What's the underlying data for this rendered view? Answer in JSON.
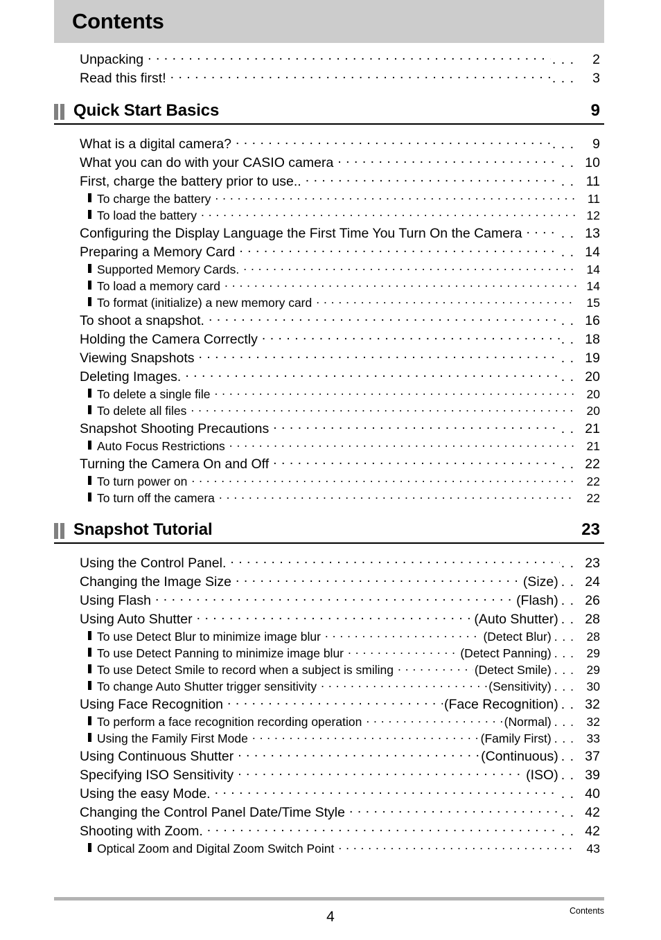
{
  "header": {
    "title": "Contents",
    "band_color": "#cccccc"
  },
  "footer": {
    "page_number": "4",
    "label": "Contents",
    "bar_color": "#b3b3b3"
  },
  "icons": {
    "section_marker": "double-bar-icon",
    "sub_item_marker": "bar-bullet-icon"
  },
  "intro_entries": [
    {
      "label": "Unpacking",
      "suffix": "",
      "tail": ". . .",
      "page": "2"
    },
    {
      "label": "Read this first!",
      "suffix": "",
      "tail": ". . .",
      "page": "3"
    }
  ],
  "sections": [
    {
      "title": "Quick Start Basics",
      "page": "9",
      "entries": [
        {
          "level": 1,
          "label": "What is a digital camera?",
          "suffix": "",
          "tail": ". . .",
          "page": "9"
        },
        {
          "level": 1,
          "label": "What you can do with your CASIO camera",
          "suffix": "",
          "tail": ". .",
          "page": "10"
        },
        {
          "level": 1,
          "label": "First, charge the battery prior to use..",
          "suffix": "",
          "tail": ". .",
          "page": "11"
        },
        {
          "level": 2,
          "label": "To charge the battery",
          "suffix": "",
          "tail": "",
          "page": "11"
        },
        {
          "level": 2,
          "label": "To load the battery",
          "suffix": "",
          "tail": "",
          "page": "12"
        },
        {
          "level": 1,
          "label": "Configuring the Display Language the First Time You Turn On the Camera",
          "suffix": "",
          "tail": ". .",
          "page": "13"
        },
        {
          "level": 1,
          "label": "Preparing a Memory Card",
          "suffix": "",
          "tail": ". .",
          "page": "14"
        },
        {
          "level": 2,
          "label": "Supported Memory Cards.",
          "suffix": "",
          "tail": "",
          "page": "14"
        },
        {
          "level": 2,
          "label": "To load a memory card",
          "suffix": "",
          "tail": "",
          "page": "14"
        },
        {
          "level": 2,
          "label": "To format (initialize) a new memory card",
          "suffix": "",
          "tail": "",
          "page": "15"
        },
        {
          "level": 1,
          "label": "To shoot a snapshot.",
          "suffix": "",
          "tail": ". .",
          "page": "16"
        },
        {
          "level": 1,
          "label": "Holding the Camera Correctly",
          "suffix": "",
          "tail": ". .",
          "page": "18"
        },
        {
          "level": 1,
          "label": "Viewing Snapshots",
          "suffix": "",
          "tail": ". .",
          "page": "19"
        },
        {
          "level": 1,
          "label": "Deleting Images.",
          "suffix": "",
          "tail": ". .",
          "page": "20"
        },
        {
          "level": 2,
          "label": "To delete a single file",
          "suffix": "",
          "tail": "",
          "page": "20"
        },
        {
          "level": 2,
          "label": "To delete all files",
          "suffix": "",
          "tail": "",
          "page": "20"
        },
        {
          "level": 1,
          "label": "Snapshot Shooting Precautions",
          "suffix": "",
          "tail": ". .",
          "page": "21"
        },
        {
          "level": 2,
          "label": "Auto Focus Restrictions",
          "suffix": "",
          "tail": "",
          "page": "21"
        },
        {
          "level": 1,
          "label": "Turning the Camera On and Off",
          "suffix": "",
          "tail": ". .",
          "page": "22"
        },
        {
          "level": 2,
          "label": "To turn power on",
          "suffix": "",
          "tail": "",
          "page": "22"
        },
        {
          "level": 2,
          "label": "To turn off the camera",
          "suffix": "",
          "tail": "",
          "page": "22"
        }
      ]
    },
    {
      "title": "Snapshot Tutorial",
      "page": "23",
      "entries": [
        {
          "level": 1,
          "label": "Using the Control Panel.",
          "suffix": "",
          "tail": ". .",
          "page": "23"
        },
        {
          "level": 1,
          "label": "Changing the Image Size",
          "suffix": "(Size)",
          "tail": ". .",
          "page": "24"
        },
        {
          "level": 1,
          "label": "Using Flash",
          "suffix": "(Flash)",
          "tail": ". .",
          "page": "26"
        },
        {
          "level": 1,
          "label": "Using Auto Shutter",
          "suffix": "(Auto Shutter)",
          "tail": ". .",
          "page": "28"
        },
        {
          "level": 2,
          "label": "To use Detect Blur to minimize image blur",
          "suffix": "(Detect Blur)",
          "tail": ". . .",
          "page": "28"
        },
        {
          "level": 2,
          "label": "To use Detect Panning to minimize image blur",
          "suffix": "(Detect Panning)",
          "tail": ". . .",
          "page": "29"
        },
        {
          "level": 2,
          "label": "To use Detect Smile to record when a subject is smiling",
          "suffix": "(Detect Smile)",
          "tail": ". . .",
          "page": "29"
        },
        {
          "level": 2,
          "label": "To change Auto Shutter trigger sensitivity",
          "suffix": "(Sensitivity)",
          "tail": ". . .",
          "page": "30"
        },
        {
          "level": 1,
          "label": "Using Face Recognition",
          "suffix": "(Face Recognition)",
          "tail": ". .",
          "page": "32"
        },
        {
          "level": 2,
          "label": "To perform a face recognition recording operation",
          "suffix": "(Normal)",
          "tail": ". . .",
          "page": "32"
        },
        {
          "level": 2,
          "label": "Using the Family First Mode",
          "suffix": "(Family First)",
          "tail": ". . .",
          "page": "33"
        },
        {
          "level": 1,
          "label": "Using Continuous Shutter",
          "suffix": "(Continuous)",
          "tail": ". .",
          "page": "37"
        },
        {
          "level": 1,
          "label": "Specifying ISO Sensitivity",
          "suffix": "(ISO)",
          "tail": ". .",
          "page": "39"
        },
        {
          "level": 1,
          "label": "Using the easy Mode.",
          "suffix": "",
          "tail": ". .",
          "page": "40"
        },
        {
          "level": 1,
          "label": "Changing the Control Panel Date/Time Style",
          "suffix": "",
          "tail": ". .",
          "page": "42"
        },
        {
          "level": 1,
          "label": "Shooting with Zoom.",
          "suffix": "",
          "tail": ". .",
          "page": "42"
        },
        {
          "level": 2,
          "label": "Optical Zoom and Digital Zoom Switch Point",
          "suffix": "",
          "tail": "",
          "page": "43"
        }
      ]
    }
  ]
}
